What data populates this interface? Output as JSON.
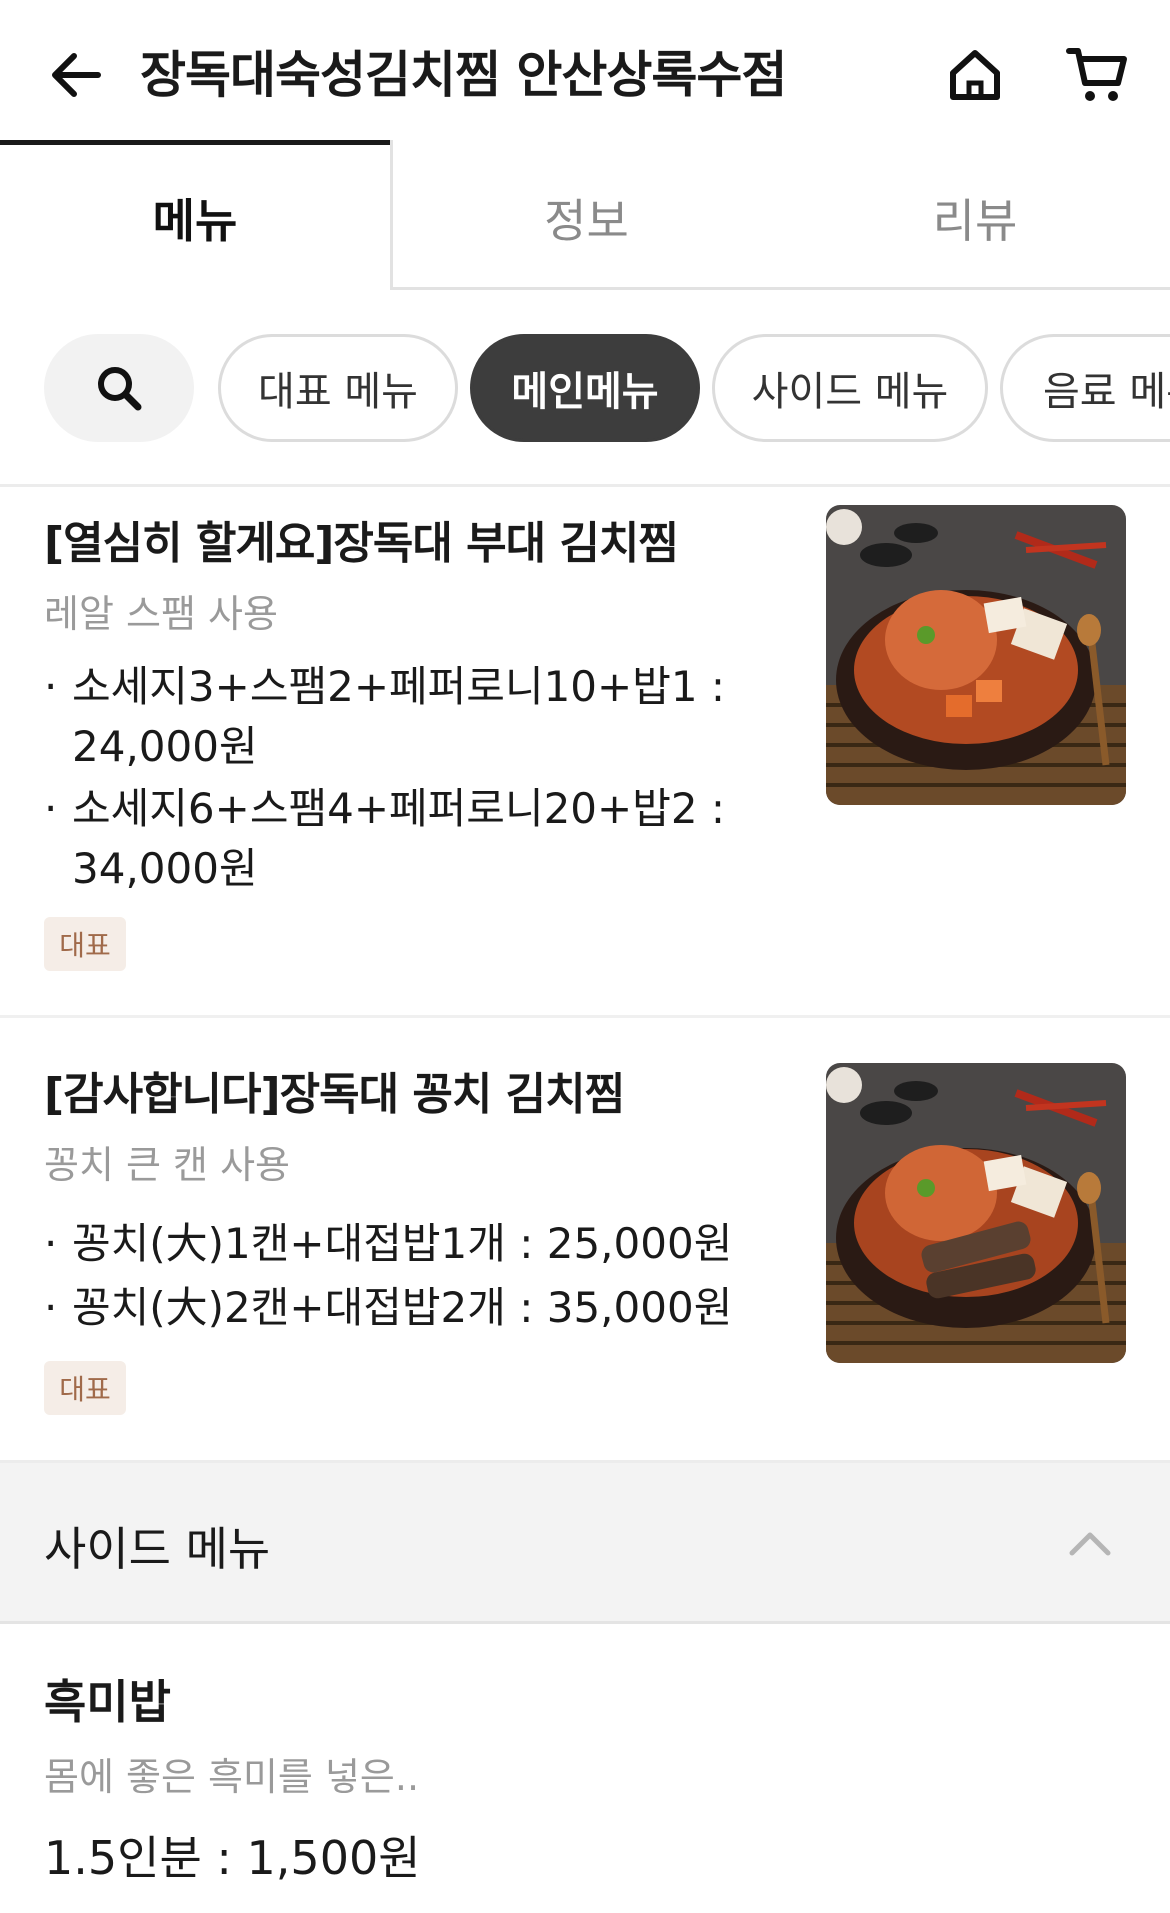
{
  "header": {
    "title": "장독대숙성김치찜 안산상록수점"
  },
  "tabs": [
    {
      "label": "메뉴",
      "active": true
    },
    {
      "label": "정보",
      "active": false
    },
    {
      "label": "리뷰",
      "active": false
    }
  ],
  "categories": [
    {
      "label": "대표 메뉴",
      "active": false
    },
    {
      "label": "메인메뉴",
      "active": true
    },
    {
      "label": "사이드 메뉴",
      "active": false
    },
    {
      "label": "음료 메뉴",
      "active": false
    }
  ],
  "items": [
    {
      "title": "[열심히 할게요]장독대 부대 김치찜",
      "description": "레알 스팸 사용",
      "options": [
        {
          "line1": "소세지3+스팸2+페퍼로니10+밥1 :",
          "line2": "24,000원"
        },
        {
          "line1": "소세지6+스팸4+페퍼로니20+밥2 :",
          "line2": "34,000원"
        }
      ],
      "badge": "대표"
    },
    {
      "title": "[감사합니다]장독대 꽁치 김치찜",
      "description": "꽁치 큰 캔 사용",
      "options": [
        {
          "line1": "꽁치(大)1캔+대접밥1개 : 25,000원"
        },
        {
          "line1": "꽁치(大)2캔+대접밥2개 : 35,000원"
        }
      ],
      "badge": "대표"
    }
  ],
  "side_section": {
    "title": "사이드 메뉴",
    "item": {
      "title": "흑미밥",
      "description": "몸에 좋은 흑미를 넣은..",
      "price_line": "1.5인분 : 1,500원"
    }
  },
  "colors": {
    "active_chip": "#3d3d3d",
    "badge_bg": "#f5ede7",
    "badge_text": "#a06a4a"
  }
}
